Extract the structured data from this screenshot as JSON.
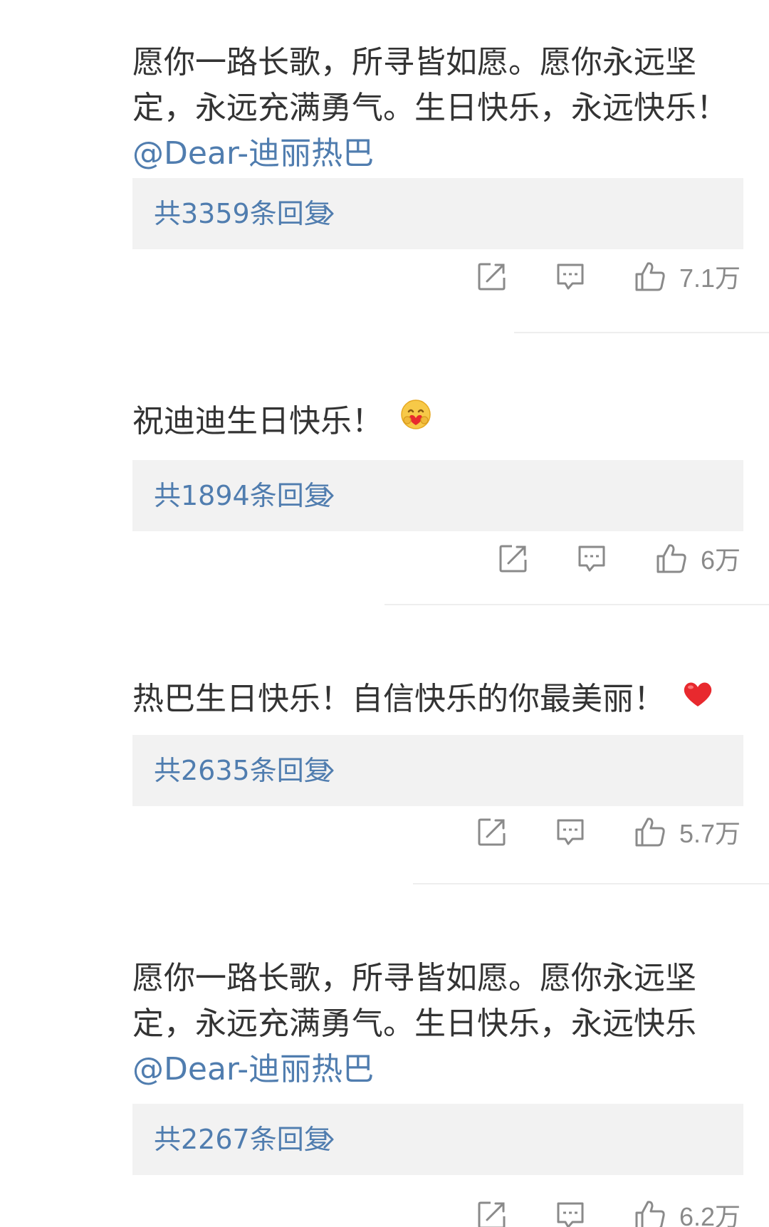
{
  "comments": [
    {
      "text": "愿你一路长歌，所寻皆如愿。愿你永远坚定，永远充满勇气。生日快乐，永远快乐！",
      "mention": "@Dear-迪丽热巴",
      "reply_label": "共3359条回复",
      "likes": "7.1万"
    },
    {
      "text": "祝迪迪生日快乐！",
      "emoji": "hug-heart-face-emoji",
      "reply_label": "共1894条回复",
      "likes": "6万"
    },
    {
      "text": "热巴生日快乐！自信快乐的你最美丽！",
      "emoji": "red-heart-emoji",
      "reply_label": "共2635条回复",
      "likes": "5.7万"
    },
    {
      "text": "愿你一路长歌，所寻皆如愿。愿你永远坚定，永远充满勇气。生日快乐，永远快乐",
      "mention": "@Dear-迪丽热巴",
      "reply_label": "共2267条回复",
      "likes": "6.2万"
    }
  ],
  "icons": {
    "share": "share-icon",
    "comment": "comment-icon",
    "like": "thumbs-up-icon",
    "chevron": "chevron-right-icon"
  },
  "colors": {
    "text": "#333333",
    "link": "#507daf",
    "reply_bg": "#f2f2f2",
    "muted": "#8a8a8a",
    "heart": "#e8292e"
  }
}
